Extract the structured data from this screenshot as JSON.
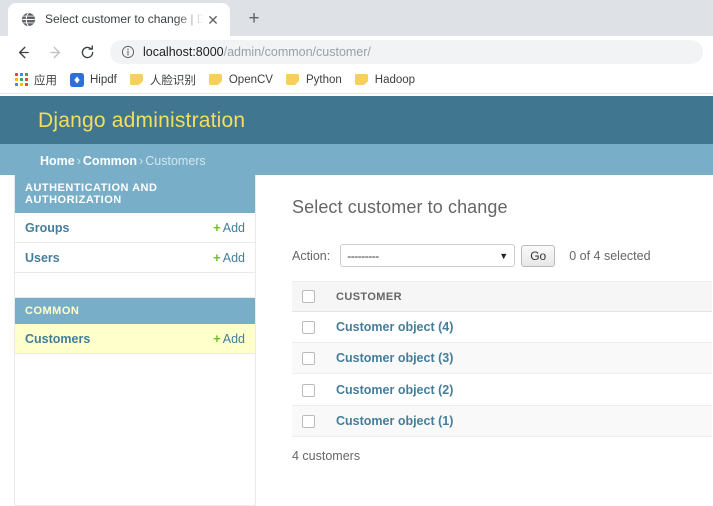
{
  "browser": {
    "tab": {
      "title": "Select customer to change | Dj",
      "favicon": "globe-icon",
      "close": "✕"
    },
    "new_tab_label": "+",
    "nav": {
      "back": "←",
      "forward": "→",
      "reload": "⟳"
    },
    "omnibox": {
      "info_icon": "info-circle-icon",
      "host": "localhost:8000",
      "path": "/admin/common/customer/"
    },
    "bookmarks": [
      {
        "label": "应用",
        "icon": "apps-grid-icon"
      },
      {
        "label": "Hipdf",
        "icon": "hipdf-icon"
      },
      {
        "label": "人脸识别",
        "icon": "folder-icon"
      },
      {
        "label": "OpenCV",
        "icon": "folder-icon"
      },
      {
        "label": "Python",
        "icon": "folder-icon"
      },
      {
        "label": "Hadoop",
        "icon": "folder-icon"
      }
    ]
  },
  "django": {
    "site_title": "Django administration",
    "breadcrumbs": [
      {
        "label": "Home",
        "link": true
      },
      {
        "label": "Common",
        "link": true
      },
      {
        "label": "Customers",
        "link": false
      }
    ],
    "breadcrumb_separator": "›"
  },
  "sidebar": {
    "apps": [
      {
        "caption": "AUTHENTICATION AND AUTHORIZATION",
        "current": false,
        "models": [
          {
            "name": "Groups",
            "add_label": "Add",
            "plus": "+",
            "current": false
          },
          {
            "name": "Users",
            "add_label": "Add",
            "plus": "+",
            "current": false
          }
        ]
      },
      {
        "caption": "COMMON",
        "current": true,
        "models": [
          {
            "name": "Customers",
            "add_label": "Add",
            "plus": "+",
            "current": true
          }
        ]
      }
    ]
  },
  "main": {
    "page_title": "Select customer to change",
    "action_label": "Action:",
    "action_selected": "---------",
    "action_chevron": "▼",
    "go_label": "Go",
    "selected_count": "0 of 4 selected",
    "table": {
      "columns": [
        "CUSTOMER"
      ],
      "rows": [
        {
          "label": "Customer object (4)"
        },
        {
          "label": "Customer object (3)"
        },
        {
          "label": "Customer object (2)"
        },
        {
          "label": "Customer object (1)"
        }
      ]
    },
    "paginator": "4 customers"
  },
  "colors": {
    "django_header": "#417690",
    "django_header_text": "#f5dd5d",
    "breadcrumb_bg": "#79aec8",
    "link": "#447e9b",
    "add_green": "#70bf2b",
    "current_row": "#ffffcc"
  }
}
